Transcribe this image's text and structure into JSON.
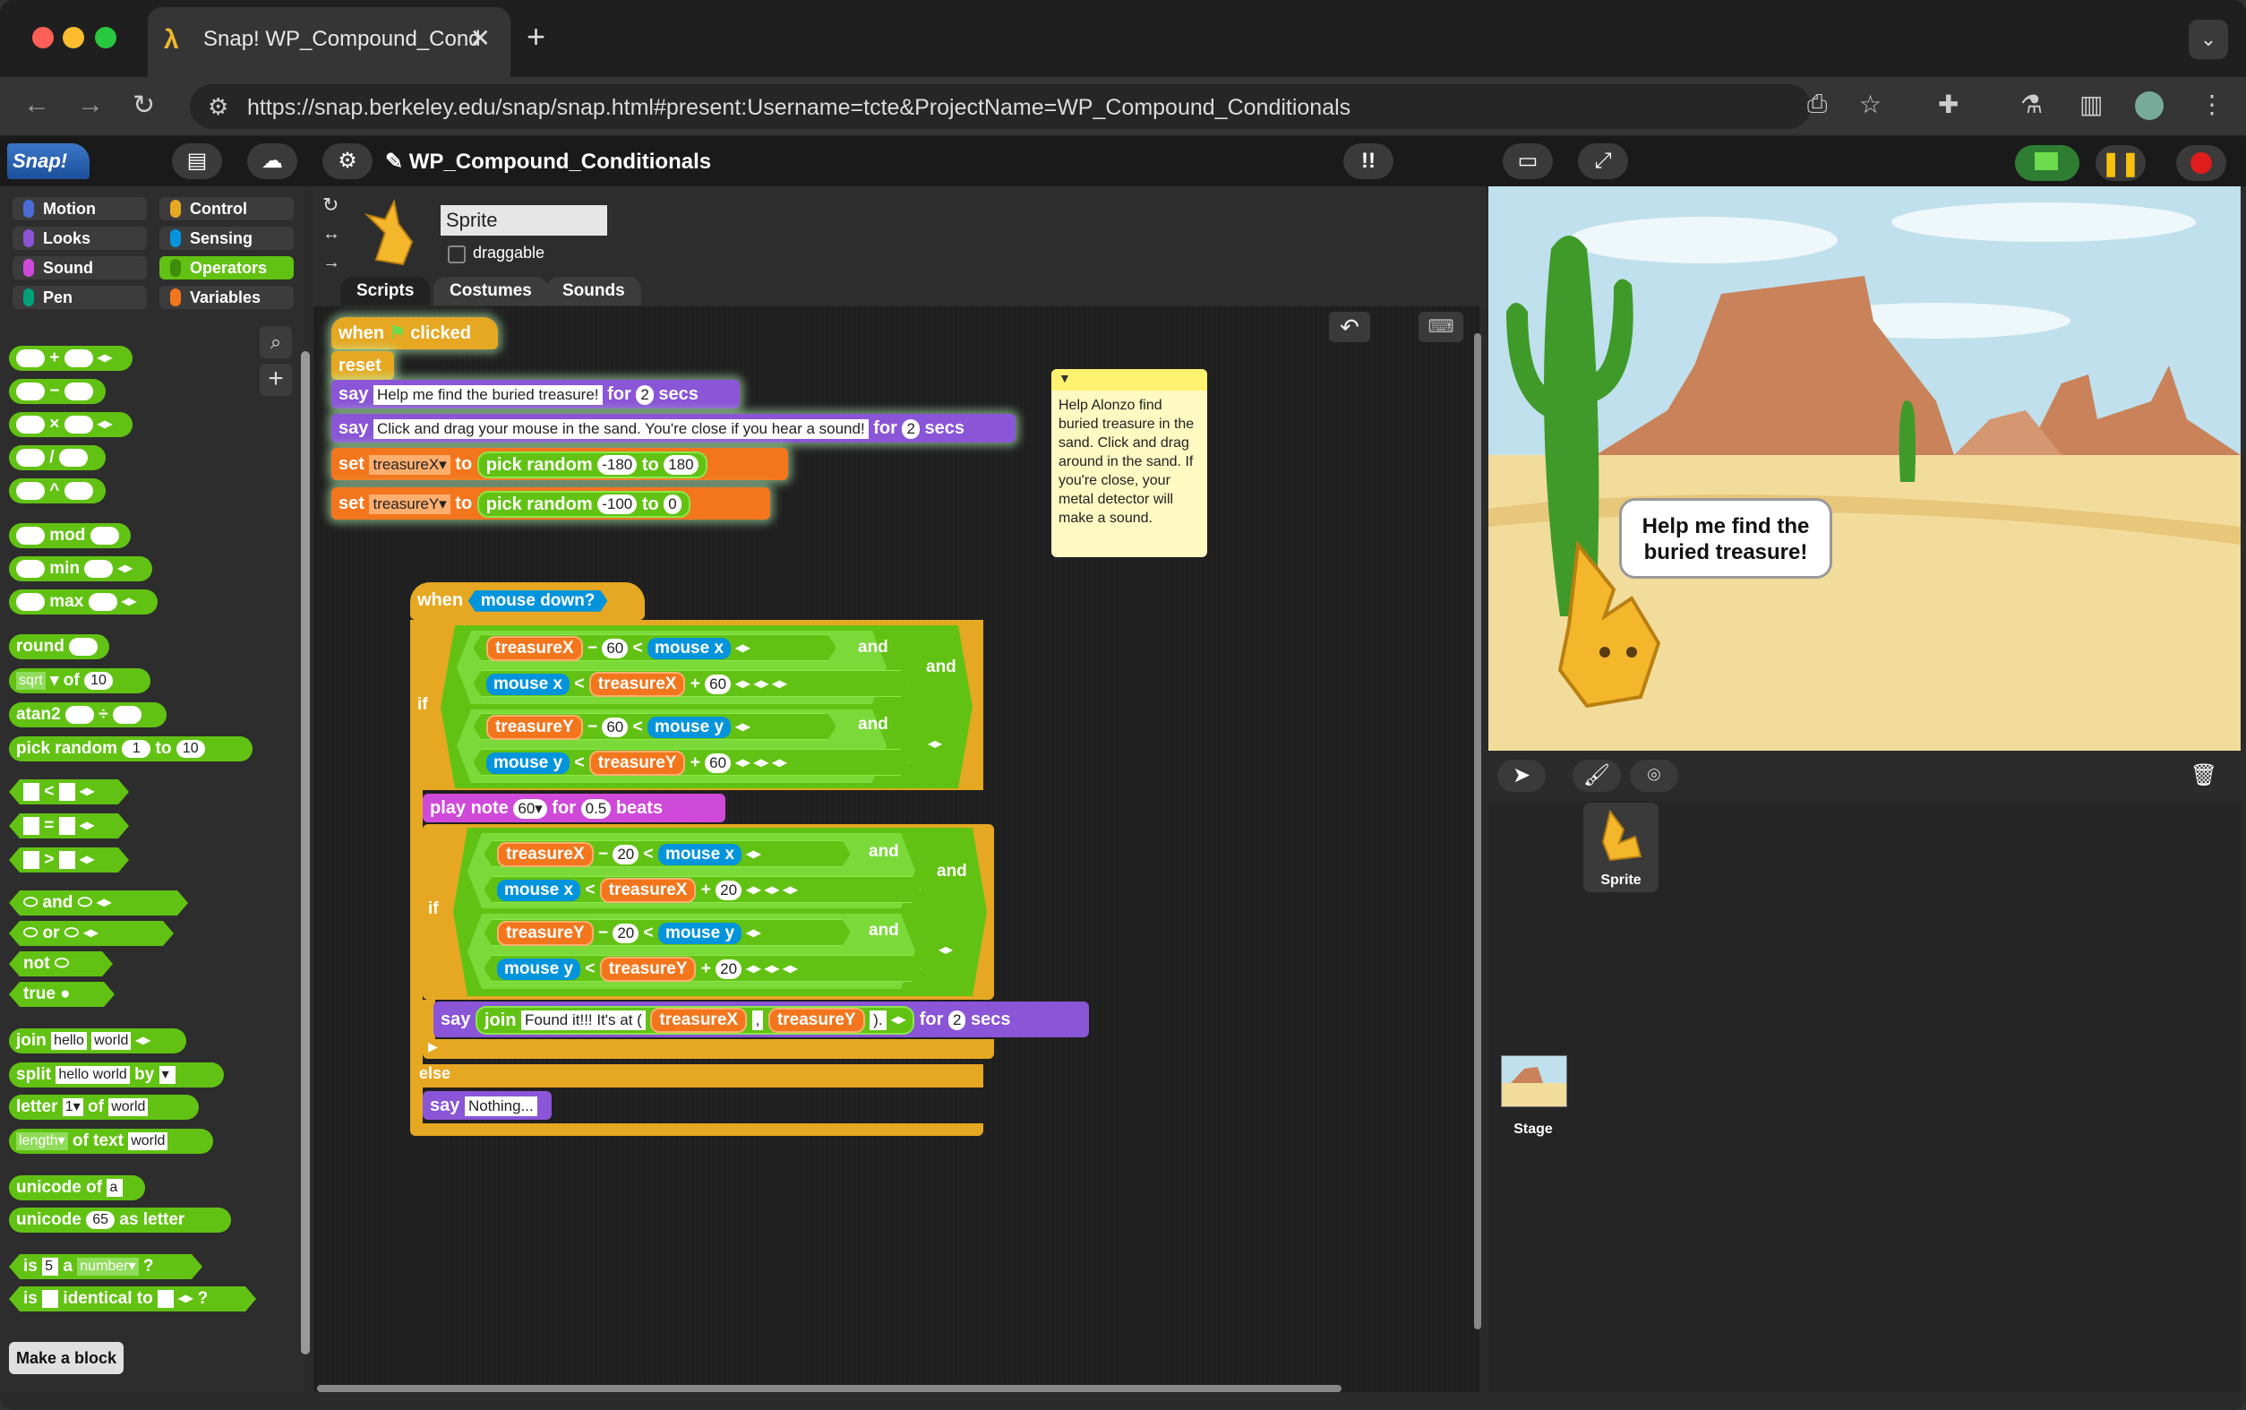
{
  "browser": {
    "tab_title": "Snap! WP_Compound_Cond",
    "url": "https://snap.berkeley.edu/snap/snap.html#present:Username=tcte&ProjectName=WP_Compound_Conditionals"
  },
  "snap": {
    "logo": "Snap!",
    "project_title": "WP_Compound_Conditionals"
  },
  "categories": [
    {
      "label": "Motion",
      "color": "#4a6cd4"
    },
    {
      "label": "Control",
      "color": "#e6a822"
    },
    {
      "label": "Looks",
      "color": "#8a55d7"
    },
    {
      "label": "Sensing",
      "color": "#0494dc"
    },
    {
      "label": "Sound",
      "color": "#cf4ad9"
    },
    {
      "label": "Operators",
      "color": "#62c213"
    },
    {
      "label": "Pen",
      "color": "#00a178"
    },
    {
      "label": "Variables",
      "color": "#f3761d"
    }
  ],
  "palette": {
    "mod": "mod",
    "min": "min",
    "max": "max",
    "round": "round",
    "sqrt": "sqrt",
    "of": "of",
    "sqrt_val": "10",
    "atan2": "atan2",
    "pick_random": "pick random",
    "to": "to",
    "pr_from": "1",
    "pr_to": "10",
    "and": "and",
    "or": "or",
    "not": "not",
    "true": "true",
    "join": "join",
    "join_a": "hello",
    "join_b": "world",
    "split": "split",
    "split_a": "hello world",
    "by": "by",
    "letter": "letter",
    "letter_n": "1",
    "of_text": "of",
    "letter_w": "world",
    "length": "length",
    "of_text2": "of text",
    "length_w": "world",
    "unicode_of": "unicode of",
    "unicode_a": "a",
    "unicode": "unicode",
    "unicode_n": "65",
    "as_letter": "as letter",
    "is": "is",
    "is_n": "5",
    "a": "a",
    "number": "number",
    "q": "?",
    "identical_to": "identical to",
    "make_block": "Make a block"
  },
  "sprite": {
    "name": "Sprite",
    "draggable": "draggable",
    "tabs": [
      "Scripts",
      "Costumes",
      "Sounds"
    ]
  },
  "script1": {
    "when": "when",
    "clicked": "clicked",
    "reset": "reset",
    "say": "say",
    "say1": "Help me find the buried treasure!",
    "for": "for",
    "secs": "secs",
    "n2": "2",
    "say2": "Click and drag your mouse in the sand. You're close if you hear a sound!",
    "set": "set",
    "treasureX": "treasureX",
    "treasureY": "treasureY",
    "to": "to",
    "pick_random": "pick random",
    "x_from": "-180",
    "x_to": "180",
    "y_from": "-100",
    "y_to": "0"
  },
  "comment": "Help Alonzo find buried treasure in the sand. Click and drag around in the sand. If you're close, your metal detector will make a sound.",
  "script2": {
    "when": "when",
    "mouse_down": "mouse down?",
    "if": "if",
    "else": "else",
    "and": "and",
    "treasureX": "treasureX",
    "treasureY": "treasureY",
    "mouse_x": "mouse x",
    "mouse_y": "mouse y",
    "minus": "−",
    "plus": "+",
    "lt": "<",
    "n60": "60",
    "n20": "20",
    "play_note": "play note",
    "note": "60",
    "for": "for",
    "beats_val": "0.5",
    "beats": "beats",
    "say": "say",
    "join": "join",
    "found": "Found it!!! It's at (",
    "comma": ",",
    "close": ").",
    "secs": "secs",
    "n2": "2",
    "nothing": "Nothing..."
  },
  "stage": {
    "bubble": "Help me find the buried treasure!",
    "sprite_label": "Sprite",
    "stage_label": "Stage"
  }
}
